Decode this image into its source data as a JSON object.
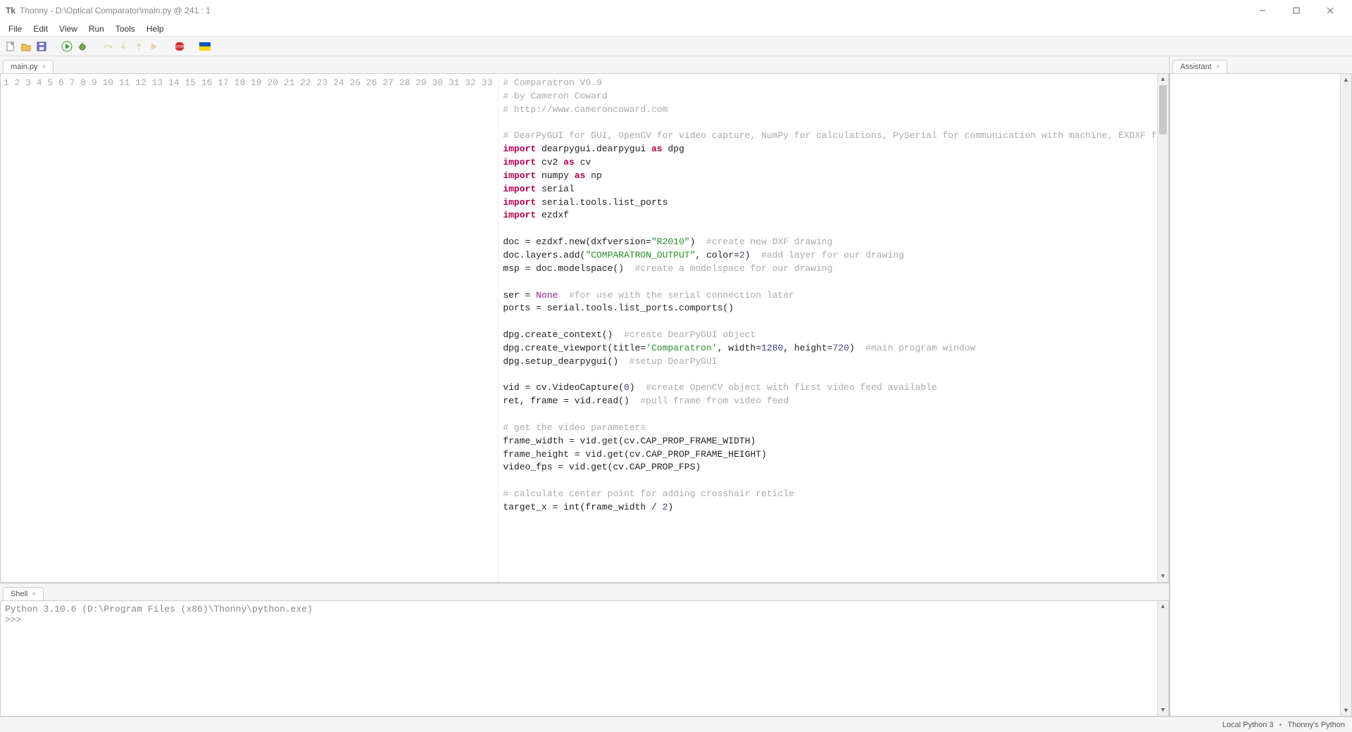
{
  "window": {
    "title": "Thonny  -  D:\\Optical Comparator\\main.py  @  241 : 1"
  },
  "menu": {
    "file": "File",
    "edit": "Edit",
    "view": "View",
    "run": "Run",
    "tools": "Tools",
    "help": "Help"
  },
  "tabs": {
    "editor_tab": "main.py",
    "shell_tab": "Shell",
    "assistant_tab": "Assistant"
  },
  "code": {
    "lines": [
      {
        "n": 1,
        "t": [
          [
            "cm",
            "# Comparatron V0.9"
          ]
        ]
      },
      {
        "n": 2,
        "t": [
          [
            "cm",
            "# by Cameron Coward"
          ]
        ]
      },
      {
        "n": 3,
        "t": [
          [
            "cm",
            "# http://www.cameroncoward.com"
          ]
        ]
      },
      {
        "n": 4,
        "t": [
          [
            "",
            ""
          ]
        ]
      },
      {
        "n": 5,
        "t": [
          [
            "cm",
            "# DearPyGUI for GUI, OpenCV for video capture, NumPy for calculations, PySerial for communication with machine, EXDXF for creating DXF drawings"
          ]
        ]
      },
      {
        "n": 6,
        "t": [
          [
            "kw",
            "import"
          ],
          [
            "",
            " dearpygui.dearpygui "
          ],
          [
            "kw",
            "as"
          ],
          [
            "",
            " dpg"
          ]
        ]
      },
      {
        "n": 7,
        "t": [
          [
            "kw",
            "import"
          ],
          [
            "",
            " cv2 "
          ],
          [
            "kw",
            "as"
          ],
          [
            "",
            " cv"
          ]
        ]
      },
      {
        "n": 8,
        "t": [
          [
            "kw",
            "import"
          ],
          [
            "",
            " numpy "
          ],
          [
            "kw",
            "as"
          ],
          [
            "",
            " np"
          ]
        ]
      },
      {
        "n": 9,
        "t": [
          [
            "kw",
            "import"
          ],
          [
            "",
            " serial"
          ]
        ]
      },
      {
        "n": 10,
        "t": [
          [
            "kw",
            "import"
          ],
          [
            "",
            " serial.tools.list_ports"
          ]
        ]
      },
      {
        "n": 11,
        "t": [
          [
            "kw",
            "import"
          ],
          [
            "",
            " ezdxf"
          ]
        ]
      },
      {
        "n": 12,
        "t": [
          [
            "",
            ""
          ]
        ]
      },
      {
        "n": 13,
        "t": [
          [
            "",
            "doc = ezdxf.new(dxfversion="
          ],
          [
            "st",
            "\"R2010\""
          ],
          [
            "",
            ")  "
          ],
          [
            "cm",
            "#create new DXF drawing"
          ]
        ]
      },
      {
        "n": 14,
        "t": [
          [
            "",
            "doc.layers.add("
          ],
          [
            "st",
            "\"COMPARATRON_OUTPUT\""
          ],
          [
            "",
            ", color="
          ],
          [
            "nm",
            "2"
          ],
          [
            "",
            ")  "
          ],
          [
            "cm",
            "#add layer for our drawing"
          ]
        ]
      },
      {
        "n": 15,
        "t": [
          [
            "",
            "msp = doc.modelspace()  "
          ],
          [
            "cm",
            "#create a modelspace for our drawing"
          ]
        ]
      },
      {
        "n": 16,
        "t": [
          [
            "",
            ""
          ]
        ]
      },
      {
        "n": 17,
        "t": [
          [
            "",
            "ser = "
          ],
          [
            "cn",
            "None"
          ],
          [
            "",
            "  "
          ],
          [
            "cm",
            "#for use with the serial connection later"
          ]
        ]
      },
      {
        "n": 18,
        "t": [
          [
            "",
            "ports = serial.tools.list_ports.comports()"
          ]
        ]
      },
      {
        "n": 19,
        "t": [
          [
            "",
            ""
          ]
        ]
      },
      {
        "n": 20,
        "t": [
          [
            "",
            "dpg.create_context()  "
          ],
          [
            "cm",
            "#create DearPyGUI object"
          ]
        ]
      },
      {
        "n": 21,
        "t": [
          [
            "",
            "dpg.create_viewport(title="
          ],
          [
            "st",
            "'Comparatron'"
          ],
          [
            "",
            ", width="
          ],
          [
            "nm",
            "1280"
          ],
          [
            "",
            ", height="
          ],
          [
            "nm",
            "720"
          ],
          [
            "",
            ")  "
          ],
          [
            "cm",
            "#main program window"
          ]
        ]
      },
      {
        "n": 22,
        "t": [
          [
            "",
            "dpg.setup_dearpygui()  "
          ],
          [
            "cm",
            "#setup DearPyGUI"
          ]
        ]
      },
      {
        "n": 23,
        "t": [
          [
            "",
            ""
          ]
        ]
      },
      {
        "n": 24,
        "t": [
          [
            "",
            "vid = cv.VideoCapture("
          ],
          [
            "nm",
            "0"
          ],
          [
            "",
            ")  "
          ],
          [
            "cm",
            "#create OpenCV object with first video feed available"
          ]
        ]
      },
      {
        "n": 25,
        "t": [
          [
            "",
            "ret, frame = vid.read()  "
          ],
          [
            "cm",
            "#pull frame from video feed"
          ]
        ]
      },
      {
        "n": 26,
        "t": [
          [
            "",
            ""
          ]
        ]
      },
      {
        "n": 27,
        "t": [
          [
            "cm",
            "# get the video parameters"
          ]
        ]
      },
      {
        "n": 28,
        "t": [
          [
            "",
            "frame_width = vid.get(cv.CAP_PROP_FRAME_WIDTH)"
          ]
        ]
      },
      {
        "n": 29,
        "t": [
          [
            "",
            "frame_height = vid.get(cv.CAP_PROP_FRAME_HEIGHT)"
          ]
        ]
      },
      {
        "n": 30,
        "t": [
          [
            "",
            "video_fps = vid.get(cv.CAP_PROP_FPS)"
          ]
        ]
      },
      {
        "n": 31,
        "t": [
          [
            "",
            ""
          ]
        ]
      },
      {
        "n": 32,
        "t": [
          [
            "cm",
            "# calculate center point for adding crosshair reticle"
          ]
        ]
      },
      {
        "n": 33,
        "t": [
          [
            "",
            "target_x = int(frame_width / "
          ],
          [
            "nm",
            "2"
          ],
          [
            "",
            ")"
          ]
        ]
      }
    ]
  },
  "shell": {
    "banner": "Python 3.10.6 (D:\\Program Files (x86)\\Thonny\\python.exe)",
    "prompt": ">>> "
  },
  "status": {
    "interpreter": "Local Python 3",
    "runtime": "Thonny's Python"
  }
}
